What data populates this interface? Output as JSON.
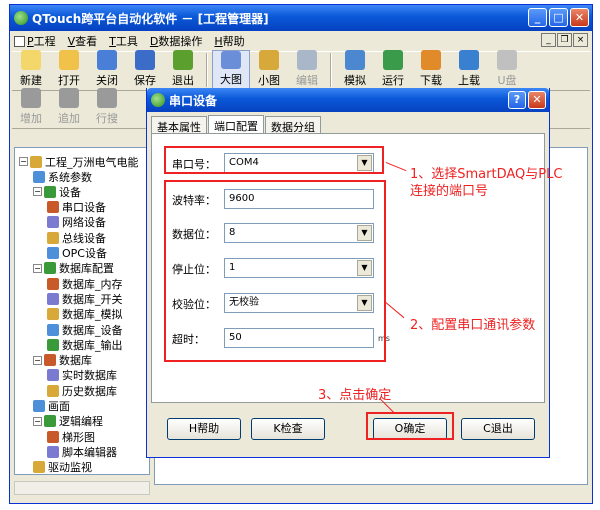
{
  "app": {
    "title": "QTouch跨平台自动化软件 － [工程管理器]",
    "menu": [
      "工程",
      "查看",
      "工具",
      "数据操作",
      "帮助"
    ],
    "menu_mnemonics": [
      "P",
      "V",
      "T",
      "D",
      "H"
    ],
    "toolbar1": [
      {
        "label": "新建",
        "icon": "new-icon"
      },
      {
        "label": "打开",
        "icon": "open-icon"
      },
      {
        "label": "关闭",
        "icon": "close-doc-icon"
      },
      {
        "label": "保存",
        "icon": "save-icon"
      },
      {
        "label": "退出",
        "icon": "exit-icon"
      },
      {
        "label": "大图",
        "icon": "large-icon-view"
      },
      {
        "label": "小图",
        "icon": "small-icon-view"
      },
      {
        "label": "编辑",
        "icon": "edit-icon",
        "disabled": true
      },
      {
        "label": "模拟",
        "icon": "simulate-icon"
      },
      {
        "label": "运行",
        "icon": "run-icon"
      },
      {
        "label": "下载",
        "icon": "download-icon"
      },
      {
        "label": "上载",
        "icon": "upload-icon"
      },
      {
        "label": "U盘",
        "icon": "usb-icon",
        "disabled": true
      }
    ],
    "toolbar2": [
      {
        "label": "增加",
        "icon": "add-icon"
      },
      {
        "label": "追加",
        "icon": "append-icon"
      },
      {
        "label": "行搜",
        "icon": "row-icon"
      }
    ]
  },
  "tree": {
    "root": "工程_万洲电气电能",
    "items": [
      {
        "label": "系统参数",
        "level": 1
      },
      {
        "label": "设备",
        "level": 1
      },
      {
        "label": "串口设备",
        "level": 2
      },
      {
        "label": "网络设备",
        "level": 2
      },
      {
        "label": "总线设备",
        "level": 2
      },
      {
        "label": "OPC设备",
        "level": 2
      },
      {
        "label": "数据库配置",
        "level": 1
      },
      {
        "label": "数据库_内存",
        "level": 2
      },
      {
        "label": "数据库_开关",
        "level": 2
      },
      {
        "label": "数据库_模拟",
        "level": 2
      },
      {
        "label": "数据库_设备",
        "level": 2
      },
      {
        "label": "数据库_输出",
        "level": 2
      },
      {
        "label": "数据库",
        "level": 1
      },
      {
        "label": "实时数据库",
        "level": 2
      },
      {
        "label": "历史数据库",
        "level": 2
      },
      {
        "label": "画面",
        "level": 1
      },
      {
        "label": "逻辑编程",
        "level": 1
      },
      {
        "label": "梯形图",
        "level": 2
      },
      {
        "label": "脚本编辑器",
        "level": 2
      },
      {
        "label": "驱动监视",
        "level": 1
      }
    ]
  },
  "dialog": {
    "title": "串口设备",
    "tabs": [
      "基本属性",
      "端口配置",
      "数据分组"
    ],
    "active_tab": 1,
    "port_label": "串口号：",
    "port_value": "COM4",
    "baud_label": "波特率：",
    "baud_value": "9600",
    "databits_label": "数据位：",
    "databits_value": "8",
    "stopbits_label": "停止位：",
    "stopbits_value": "1",
    "parity_label": "校验位：",
    "parity_value": "无校验",
    "timeout_label": "超时：",
    "timeout_value": "50",
    "timeout_unit": "ms",
    "buttons": {
      "help": "H帮助",
      "check": "K检查",
      "ok": "O确定",
      "cancel": "C退出"
    }
  },
  "annotations": {
    "a1_line1": "1、选择SmartDAQ与PLC",
    "a1_line2": "连接的端口号",
    "a2": "2、配置串口通讯参数",
    "a3": "3、点击确定"
  },
  "colors": {
    "annotation": "#e22222",
    "title": "#0a58d8"
  }
}
